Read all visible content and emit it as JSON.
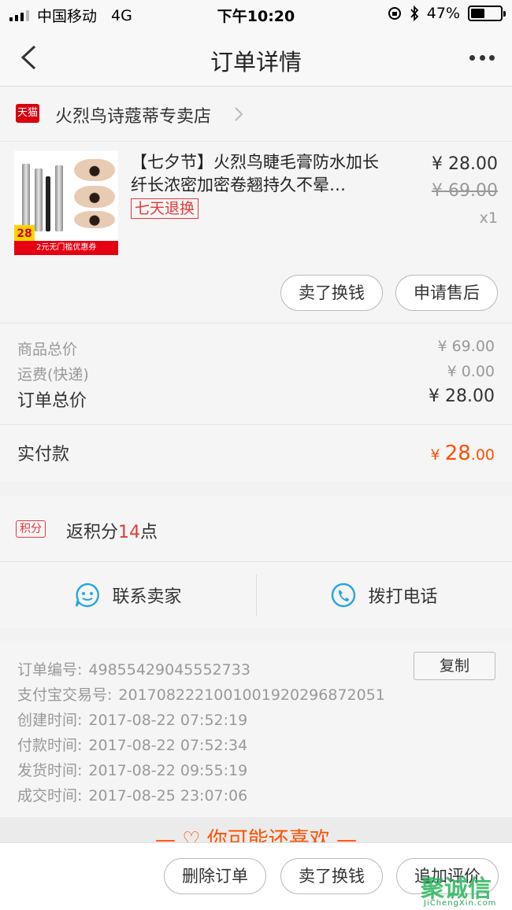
{
  "status": {
    "carrier": "中国移动",
    "network": "4G",
    "time": "下午10:20",
    "battery": "47%",
    "battery_level": 0.47
  },
  "navbar": {
    "title": "订单详情"
  },
  "shop": {
    "platform_logo": "天猫",
    "name": "火烈鸟诗蔻蒂专卖店"
  },
  "product": {
    "title": "【七夕节】火烈鸟睫毛膏防水加长纤长浓密加密卷翘持久不晕…",
    "badge": "七天退换",
    "price": "¥ 28.00",
    "original_price": "¥ 69.00",
    "quantity": "x1",
    "thumb_price": "28",
    "thumb_banner": "2元无门槛优惠券",
    "actions": {
      "sell": "卖了换钱",
      "after_sale": "申请售后"
    }
  },
  "summary": {
    "goods_label": "商品总价",
    "goods_value": "¥ 69.00",
    "shipping_label": "运费(快递)",
    "shipping_value": "¥ 0.00",
    "total_label": "订单总价",
    "total_value": "¥ 28.00",
    "paid_label": "实付款",
    "paid_currency": "¥ ",
    "paid_int": "28",
    "paid_dec": ".00"
  },
  "points": {
    "badge": "积分",
    "prefix": "返积分",
    "value": "14",
    "suffix": "点"
  },
  "contact": {
    "seller": "联系卖家",
    "phone": "拨打电话"
  },
  "order_info": {
    "copy_label": "复制",
    "rows": [
      {
        "label": "订单编号:",
        "value": "49855429045552733"
      },
      {
        "label": "支付宝交易号:",
        "value": "2017082221001001920296872051"
      },
      {
        "label": "创建时间:",
        "value": "2017-08-22 07:52:19"
      },
      {
        "label": "付款时间:",
        "value": "2017-08-22 07:52:34"
      },
      {
        "label": "发货时间:",
        "value": "2017-08-22 09:55:19"
      },
      {
        "label": "成交时间:",
        "value": "2017-08-25 23:07:06"
      }
    ]
  },
  "recommend": {
    "title": "— ♡ 你可能还喜欢 —"
  },
  "bottom": {
    "delete": "删除订单",
    "sell": "卖了换钱",
    "review": "追加评价"
  },
  "watermark": {
    "main": "聚诚信",
    "sub": "JiChengXin.com"
  },
  "colors": {
    "accent": "#ff5000",
    "brand_red": "#e4393c",
    "tmall_red": "#d9000f",
    "icon_blue": "#2aa6e0"
  }
}
